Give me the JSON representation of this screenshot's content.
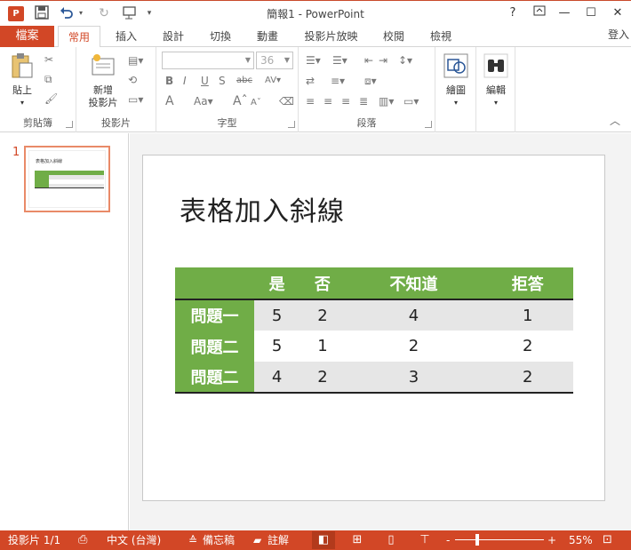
{
  "window": {
    "title": "簡報1 - PowerPoint",
    "app_icon_label": "P",
    "help_label": "?",
    "qat": {
      "undo_icon": "undo-icon",
      "redo_icon": "redo-icon"
    }
  },
  "tabs": {
    "file_label": "檔案",
    "items": [
      {
        "label": "常用",
        "active": true
      },
      {
        "label": "插入"
      },
      {
        "label": "設計"
      },
      {
        "label": "切換"
      },
      {
        "label": "動畫"
      },
      {
        "label": "投影片放映"
      },
      {
        "label": "校閱"
      },
      {
        "label": "檢視"
      }
    ],
    "signin_label": "登入"
  },
  "ribbon": {
    "clipboard": {
      "label": "剪貼簿",
      "paste_label": "貼上"
    },
    "slides": {
      "label": "投影片",
      "new_slide_line1": "新增",
      "new_slide_line2": "投影片"
    },
    "font": {
      "label": "字型",
      "font_name": "",
      "font_size": "36"
    },
    "paragraph": {
      "label": "段落"
    },
    "drawing": {
      "label": "繪圖"
    },
    "editing": {
      "label": "編輯"
    }
  },
  "thumbnail": {
    "number": "1",
    "title": "表格加入斜線"
  },
  "slide": {
    "title": "表格加入斜線",
    "table": {
      "headers": [
        "",
        "是",
        "否",
        "不知道",
        "拒答"
      ],
      "rows": [
        {
          "label": "問題一",
          "values": [
            "5",
            "2",
            "4",
            "1"
          ]
        },
        {
          "label": "問題二",
          "values": [
            "5",
            "1",
            "2",
            "2"
          ]
        },
        {
          "label": "問題二",
          "values": [
            "4",
            "2",
            "3",
            "2"
          ]
        }
      ]
    }
  },
  "statusbar": {
    "slide_info": "投影片 1/1",
    "language": "中文 (台灣)",
    "notes_label": "備忘稿",
    "comments_label": "註解",
    "zoom_minus": "-",
    "zoom_plus": "+",
    "zoom_level": "55%",
    "zoom_fraction": 0.55
  },
  "colors": {
    "accent": "#d24726",
    "table_green": "#70ad47",
    "row_band": "#e6e6e6"
  }
}
